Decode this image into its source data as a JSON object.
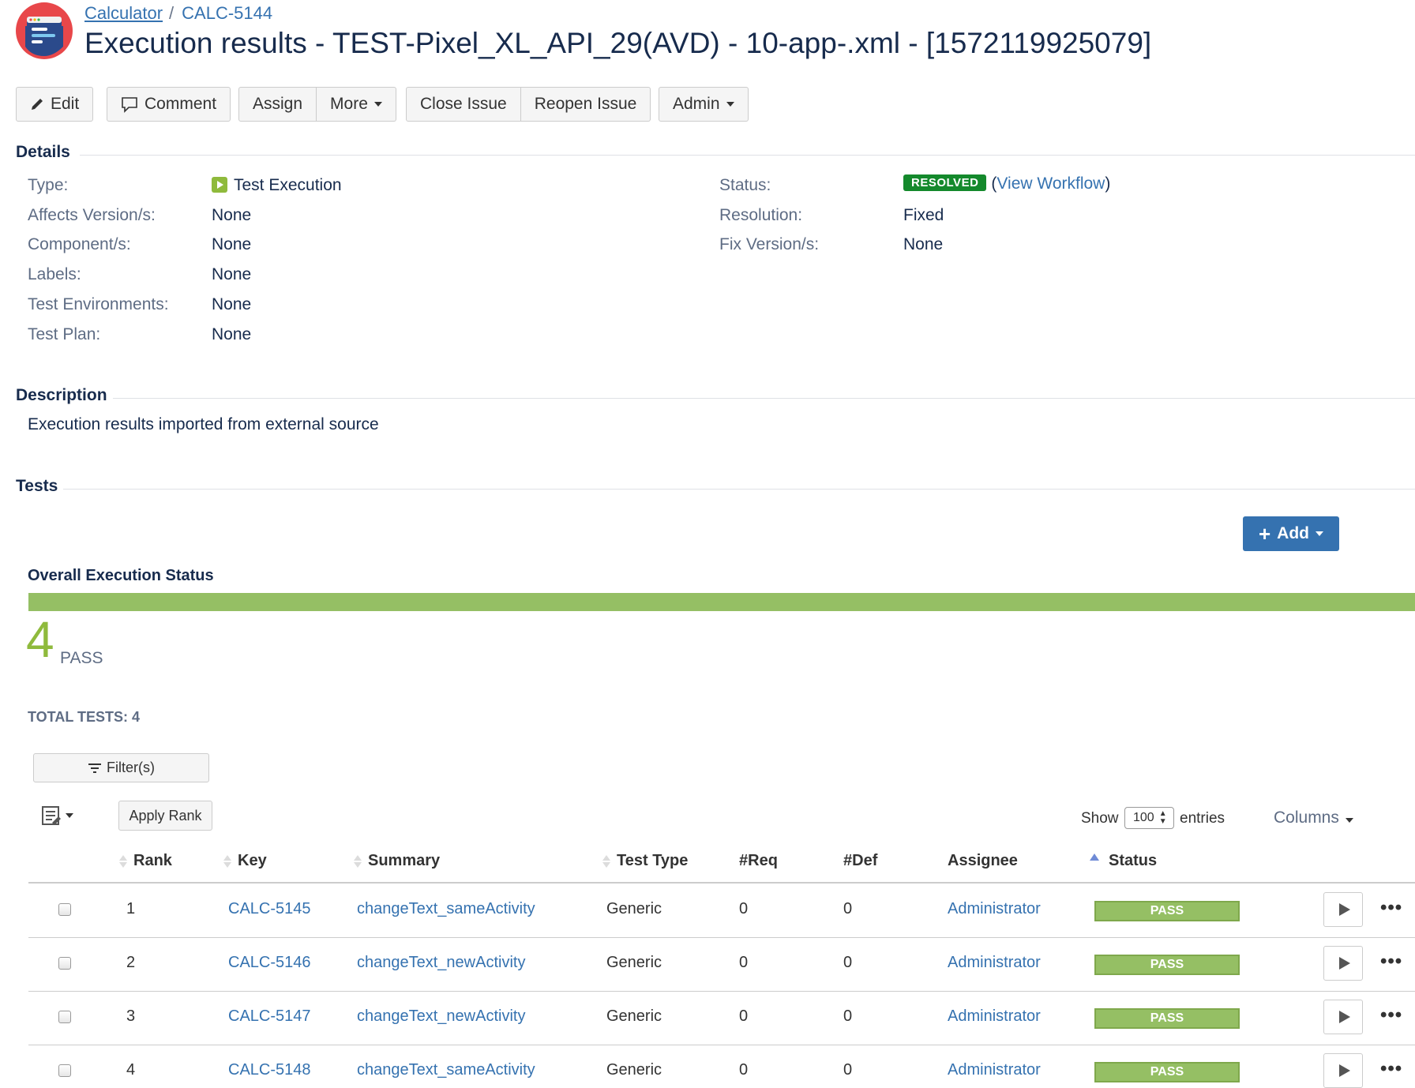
{
  "breadcrumb": {
    "project": "Calculator",
    "separator": "/",
    "parent": "CALC-5144"
  },
  "title": "Execution results - TEST-Pixel_XL_API_29(AVD) - 10-app-.xml - [1572119925079]",
  "toolbar": {
    "edit": "Edit",
    "comment": "Comment",
    "assign": "Assign",
    "more": "More",
    "close_issue": "Close Issue",
    "reopen_issue": "Reopen Issue",
    "admin": "Admin"
  },
  "details": {
    "heading": "Details",
    "type_label": "Type:",
    "type_value": "Test Execution",
    "affects_label": "Affects Version/s:",
    "affects_value": "None",
    "components_label": "Component/s:",
    "components_value": "None",
    "labels_label": "Labels:",
    "labels_value": "None",
    "env_label": "Test Environments:",
    "env_value": "None",
    "plan_label": "Test Plan:",
    "plan_value": "None",
    "status_label": "Status:",
    "status_value": "RESOLVED",
    "workflow_open": "(",
    "workflow_link": "View Workflow",
    "workflow_close": ")",
    "resolution_label": "Resolution:",
    "resolution_value": "Fixed",
    "fix_label": "Fix Version/s:",
    "fix_value": "None",
    "status_color": "#14892c"
  },
  "description": {
    "heading": "Description",
    "text": "Execution results imported from external source"
  },
  "tests": {
    "heading": "Tests",
    "add_label": "Add",
    "overall_heading": "Overall Execution Status",
    "pass_count": "4",
    "pass_label": "PASS",
    "pass_fraction": 1.0,
    "pass_color": "#95bf64",
    "total_label": "TOTAL TESTS: 4",
    "filter_label": "Filter(s)",
    "apply_rank": "Apply Rank",
    "show_label": "Show",
    "entries_value": "100",
    "entries_label": "entries",
    "columns_label": "Columns",
    "headers": [
      "Rank",
      "Key",
      "Summary",
      "Test Type",
      "#Req",
      "#Def",
      "Assignee",
      "Status"
    ],
    "rows": [
      {
        "rank": "1",
        "key": "CALC-5145",
        "summary": "changeText_sameActivity",
        "type": "Generic",
        "req": "0",
        "def": "0",
        "assignee": "Administrator",
        "status": "PASS"
      },
      {
        "rank": "2",
        "key": "CALC-5146",
        "summary": "changeText_newActivity",
        "type": "Generic",
        "req": "0",
        "def": "0",
        "assignee": "Administrator",
        "status": "PASS"
      },
      {
        "rank": "3",
        "key": "CALC-5147",
        "summary": "changeText_newActivity",
        "type": "Generic",
        "req": "0",
        "def": "0",
        "assignee": "Administrator",
        "status": "PASS"
      },
      {
        "rank": "4",
        "key": "CALC-5148",
        "summary": "changeText_sameActivity",
        "type": "Generic",
        "req": "0",
        "def": "0",
        "assignee": "Administrator",
        "status": "PASS"
      }
    ],
    "row_more": "•••"
  }
}
